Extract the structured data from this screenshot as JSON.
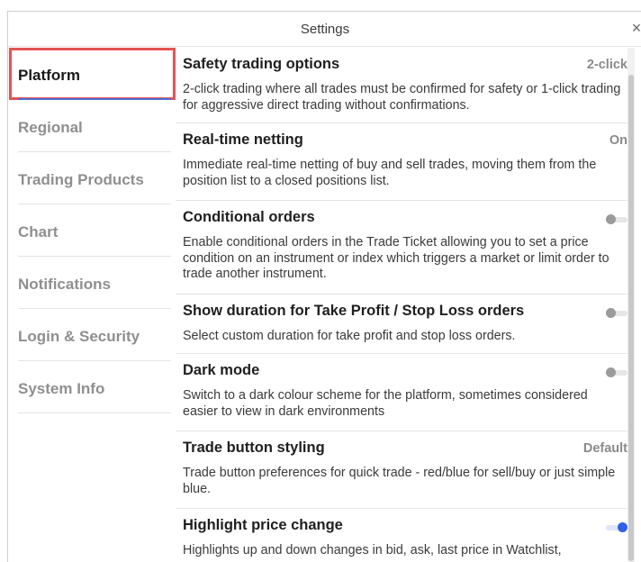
{
  "window": {
    "title": "Settings",
    "close_glyph": "×"
  },
  "sidebar": {
    "items": [
      {
        "label": "Platform",
        "active": true
      },
      {
        "label": "Regional"
      },
      {
        "label": "Trading Products"
      },
      {
        "label": "Chart"
      },
      {
        "label": "Notifications"
      },
      {
        "label": "Login & Security"
      },
      {
        "label": "System Info"
      }
    ]
  },
  "settings": [
    {
      "title": "Safety trading options",
      "value": "2-click",
      "description": "2-click trading where all trades must be confirmed for safety or 1-click trading for aggressive direct trading without confirmations."
    },
    {
      "title": "Real-time netting",
      "value": "On",
      "description": "Immediate real-time netting of buy and sell trades, moving them from the position list to a closed positions list."
    },
    {
      "title": "Conditional orders",
      "toggle": false,
      "description": "Enable conditional orders in the Trade Ticket allowing you to set a price condition on an instrument or index which triggers a market or limit order to trade another instrument."
    },
    {
      "title": "Show duration for Take Profit / Stop Loss orders",
      "toggle": false,
      "description": "Select custom duration for take profit and stop loss orders."
    },
    {
      "title": "Dark mode",
      "toggle": false,
      "description": "Switch to a dark colour scheme for the platform, sometimes considered easier to view in dark environments"
    },
    {
      "title": "Trade button styling",
      "value": "Default",
      "description": "Trade button preferences for quick trade - red/blue for sell/buy or just simple blue."
    },
    {
      "title": "Highlight price change",
      "toggle": true,
      "description": "Highlights up and down changes in bid, ask, last price in Watchlist,"
    }
  ],
  "colors": {
    "accent": "#2f62e8",
    "focus_outline": "#e55353",
    "active_underline": "#4b6fd6"
  }
}
